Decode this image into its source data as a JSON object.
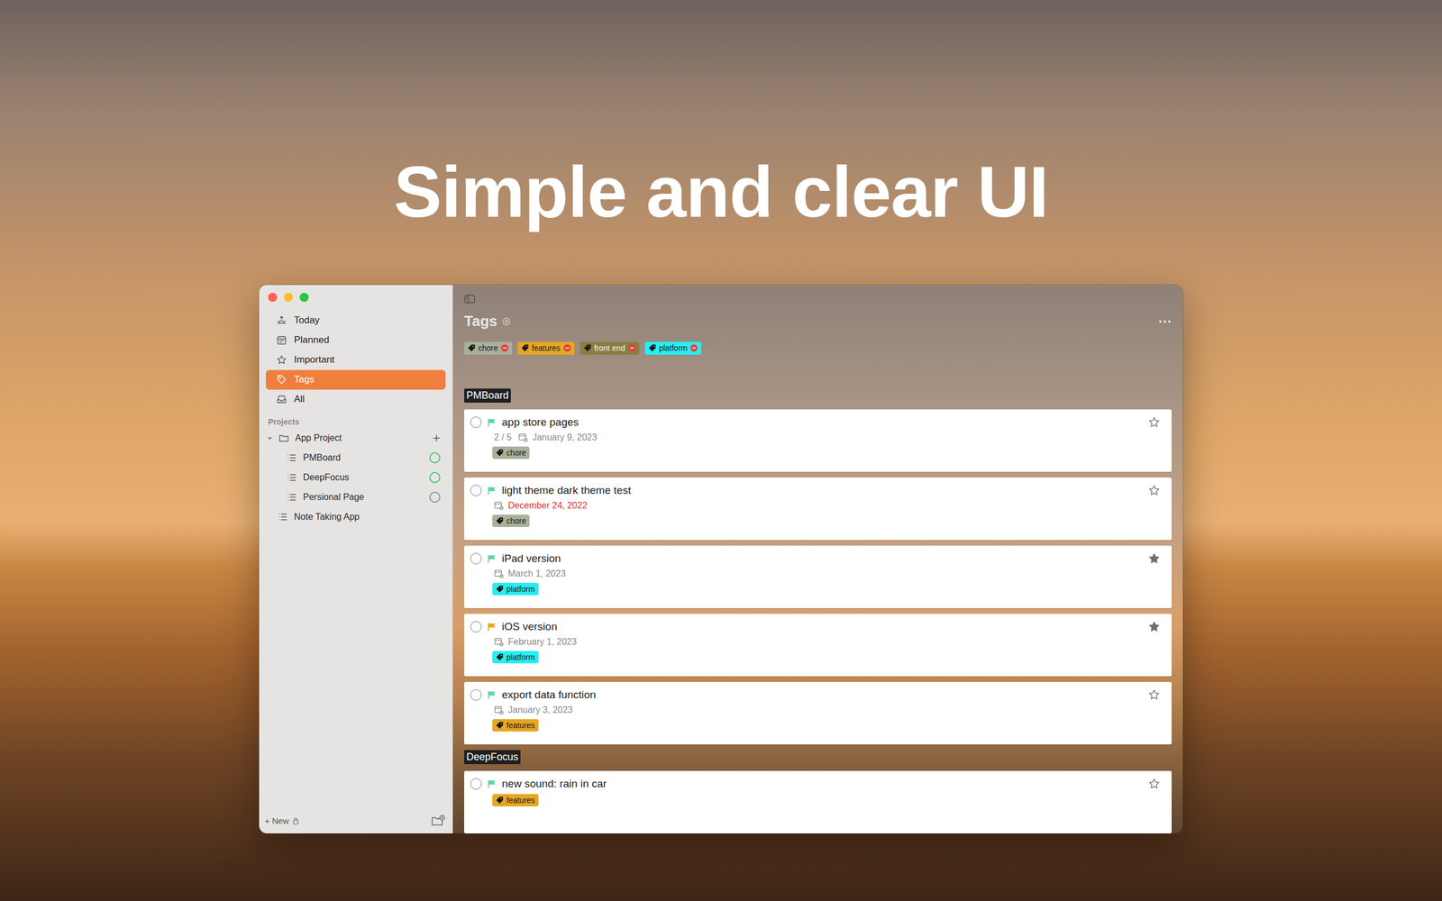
{
  "headline": "Simple and clear UI",
  "sidebar": {
    "items": [
      {
        "label": "Today",
        "selected": false
      },
      {
        "label": "Planned",
        "selected": false
      },
      {
        "label": "Important",
        "selected": false
      },
      {
        "label": "Tags",
        "selected": true
      },
      {
        "label": "All",
        "selected": false
      }
    ],
    "section_label": "Projects",
    "projects": [
      {
        "label": "App Project",
        "kind": "folder",
        "expanded": true,
        "children": [
          {
            "label": "PMBoard",
            "color": "#34c759"
          },
          {
            "label": "DeepFocus",
            "color": "#34c759"
          },
          {
            "label": "Persional Page",
            "color": "#8e8e8e"
          }
        ]
      },
      {
        "label": "Note Taking App",
        "kind": "list",
        "expanded": false,
        "children": []
      }
    ],
    "new_button": "+ New"
  },
  "main": {
    "title": "Tags",
    "filter_tags": [
      {
        "label": "chore",
        "color": "#a9b09b"
      },
      {
        "label": "features",
        "color": "#e6a623"
      },
      {
        "label": "front end",
        "color": "#8b7d3f"
      },
      {
        "label": "platform",
        "color": "#27eef2"
      }
    ],
    "groups": [
      {
        "name": "PMBoard",
        "tasks": [
          {
            "title": "app store pages",
            "flag_color": "#5cd6a6",
            "subtasks": "2 / 5",
            "date": "January 9, 2023",
            "overdue": false,
            "tag": {
              "label": "chore",
              "color": "#a9b09b"
            },
            "starred": false
          },
          {
            "title": "light theme dark theme test",
            "flag_color": "#5cd6a6",
            "date": "December 24, 2022",
            "overdue": true,
            "tag": {
              "label": "chore",
              "color": "#a9b09b"
            },
            "starred": false
          },
          {
            "title": "iPad version",
            "flag_color": "#5cd6a6",
            "date": "March 1, 2023",
            "overdue": false,
            "tag": {
              "label": "platform",
              "color": "#27eef2"
            },
            "starred": true
          },
          {
            "title": "iOS version",
            "flag_color": "#e8a319",
            "date": "February 1, 2023",
            "overdue": false,
            "tag": {
              "label": "platform",
              "color": "#27eef2"
            },
            "starred": true
          },
          {
            "title": "export data function",
            "flag_color": "#5cd6a6",
            "date": "January 3, 2023",
            "overdue": false,
            "tag": {
              "label": "features",
              "color": "#e6a623"
            },
            "starred": false
          }
        ]
      },
      {
        "name": "DeepFocus",
        "tasks": [
          {
            "title": "new sound: rain in car",
            "flag_color": "#5cd6a6",
            "overdue": false,
            "tag": {
              "label": "features",
              "color": "#e6a623"
            },
            "starred": false
          }
        ]
      }
    ]
  }
}
